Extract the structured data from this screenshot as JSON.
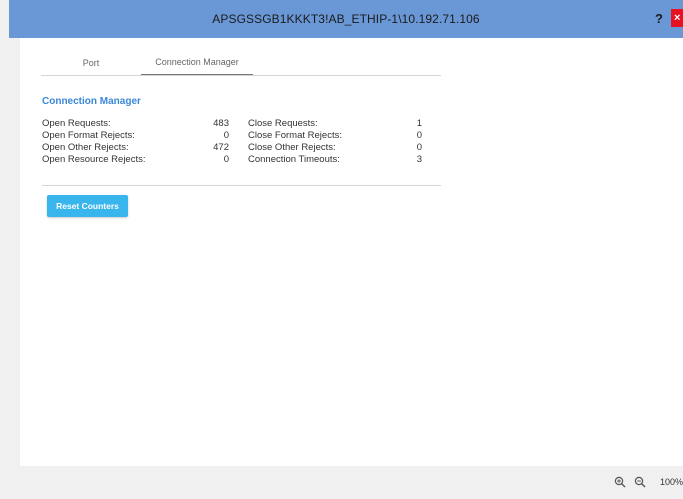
{
  "window": {
    "title": "APSGSSGB1KKKT3!AB_ETHIP-1\\10.192.71.106",
    "help_label": "?",
    "close_label": "×"
  },
  "tabs": [
    {
      "label": "Port"
    },
    {
      "label": "Connection Manager"
    }
  ],
  "section": {
    "title": "Connection Manager"
  },
  "counters": [
    {
      "left_label": "Open Requests:",
      "left_value": "483",
      "right_label": "Close Requests:",
      "right_value": "1"
    },
    {
      "left_label": "Open Format Rejects:",
      "left_value": "0",
      "right_label": "Close Format Rejects:",
      "right_value": "0"
    },
    {
      "left_label": "Open Other Rejects:",
      "left_value": "472",
      "right_label": "Close Other Rejects:",
      "right_value": "0"
    },
    {
      "left_label": "Open Resource Rejects:",
      "left_value": "0",
      "right_label": "Connection Timeouts:",
      "right_value": "3"
    }
  ],
  "actions": {
    "reset_label": "Reset Counters"
  },
  "status": {
    "zoom_level": "100%",
    "zoom_in_icon": "zoom-in-icon",
    "zoom_out_icon": "zoom-out-icon"
  },
  "colors": {
    "titlebar": "#6a97d6",
    "accent": "#3a87d6",
    "button": "#38b5ec",
    "close": "#e81123"
  }
}
